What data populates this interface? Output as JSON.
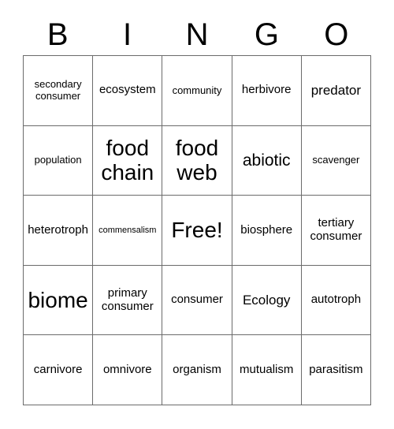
{
  "header": {
    "letters": [
      "B",
      "I",
      "N",
      "G",
      "O"
    ]
  },
  "grid": {
    "rows": [
      [
        {
          "text": "secondary\nconsumer",
          "size": "fs-sm"
        },
        {
          "text": "ecosystem",
          "size": "fs-md"
        },
        {
          "text": "community",
          "size": "fs-sm"
        },
        {
          "text": "herbivore",
          "size": "fs-md"
        },
        {
          "text": "predator",
          "size": "fs-lg"
        }
      ],
      [
        {
          "text": "population",
          "size": "fs-sm"
        },
        {
          "text": "food\nchain",
          "size": "fs-xxl"
        },
        {
          "text": "food\nweb",
          "size": "fs-xxl"
        },
        {
          "text": "abiotic",
          "size": "fs-xl"
        },
        {
          "text": "scavenger",
          "size": "fs-sm"
        }
      ],
      [
        {
          "text": "heterotroph",
          "size": "fs-md"
        },
        {
          "text": "commensalism",
          "size": "fs-xs"
        },
        {
          "text": "Free!",
          "size": "fs-xxl"
        },
        {
          "text": "biosphere",
          "size": "fs-md"
        },
        {
          "text": "tertiary\nconsumer",
          "size": "fs-md"
        }
      ],
      [
        {
          "text": "biome",
          "size": "fs-xxl"
        },
        {
          "text": "primary\nconsumer",
          "size": "fs-md"
        },
        {
          "text": "consumer",
          "size": "fs-md"
        },
        {
          "text": "Ecology",
          "size": "fs-lg"
        },
        {
          "text": "autotroph",
          "size": "fs-md"
        }
      ],
      [
        {
          "text": "carnivore",
          "size": "fs-md"
        },
        {
          "text": "omnivore",
          "size": "fs-md"
        },
        {
          "text": "organism",
          "size": "fs-md"
        },
        {
          "text": "mutualism",
          "size": "fs-md"
        },
        {
          "text": "parasitism",
          "size": "fs-md"
        }
      ]
    ]
  },
  "colors": {
    "text": "#000000",
    "background": "#ffffff",
    "grid_line": "#6b6b6b"
  }
}
